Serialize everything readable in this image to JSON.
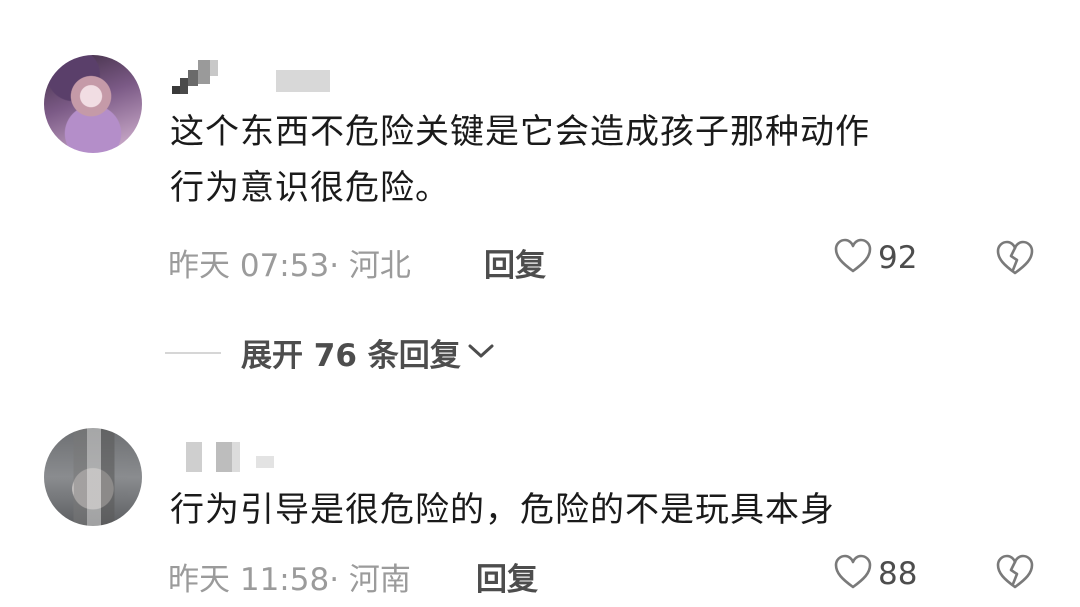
{
  "comments": [
    {
      "text_lines": [
        "这个东西不危险关键是它会造成孩子那种动作",
        "行为意识很危险。"
      ],
      "meta": "昨天 07:53· 河北",
      "reply_label": "回复",
      "likes": "92"
    },
    {
      "text_lines": [
        "行为引导是很危险的，危险的不是玩具本身"
      ],
      "meta": "昨天 11:58· 河南",
      "reply_label": "回复",
      "likes": "88"
    }
  ],
  "expand_replies": {
    "label": "展开 76 条回复"
  },
  "icons": {
    "like": "heart-outline-icon",
    "dislike": "broken-heart-icon",
    "chevron": "chevron-down-icon"
  },
  "colors": {
    "text": "#1a1a1a",
    "meta": "#9b9b9b",
    "action": "#4d4d4d",
    "icon": "#7a7a7a"
  }
}
